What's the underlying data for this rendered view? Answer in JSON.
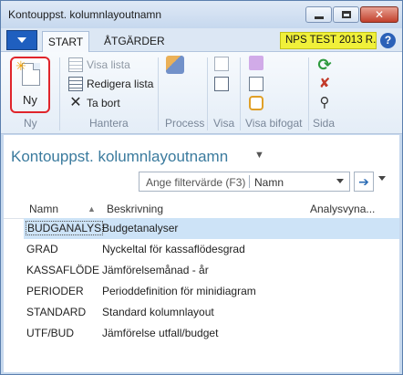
{
  "window": {
    "title": "Kontouppst. kolumnlayoutnamn"
  },
  "tabs": {
    "start": "START",
    "actions": "ÅTGÄRDER"
  },
  "company": "NPS TEST 2013 R...",
  "help": "?",
  "ribbon": {
    "new_label": "Ny",
    "groups": {
      "new": "Ny",
      "manage": "Hantera",
      "process": "Process",
      "view": "Visa",
      "attachments": "Visa bifogat",
      "page": "Sida"
    },
    "manage": {
      "view_list": "Visa lista",
      "edit_list": "Redigera lista",
      "delete": "Ta bort"
    }
  },
  "page": {
    "title": "Kontouppst. kolumnlayoutnamn",
    "filter_placeholder": "Ange filtervärde (F3)",
    "filter_field": "Namn"
  },
  "columns": {
    "name": "Namn",
    "description": "Beskrivning",
    "analysis": "Analysvyna..."
  },
  "rows": [
    {
      "name": "BUDGANALYS",
      "description": "Budgetanalyser"
    },
    {
      "name": "GRAD",
      "description": "Nyckeltal för kassaflödesgrad"
    },
    {
      "name": "KASSAFLÖDE",
      "description": "Jämförelsemånad - år"
    },
    {
      "name": "PERIODER",
      "description": "Perioddefinition för minidiagram"
    },
    {
      "name": "STANDARD",
      "description": "Standard kolumnlayout"
    },
    {
      "name": "UTF/BUD",
      "description": "Jämförelse utfall/budget"
    }
  ],
  "colors": {
    "title_text": "#3b7b9e",
    "selection": "#cde3f7",
    "app_button": "#1f5fbf",
    "company_badge": "#f0f03a",
    "new_highlight": "#e0252b"
  }
}
